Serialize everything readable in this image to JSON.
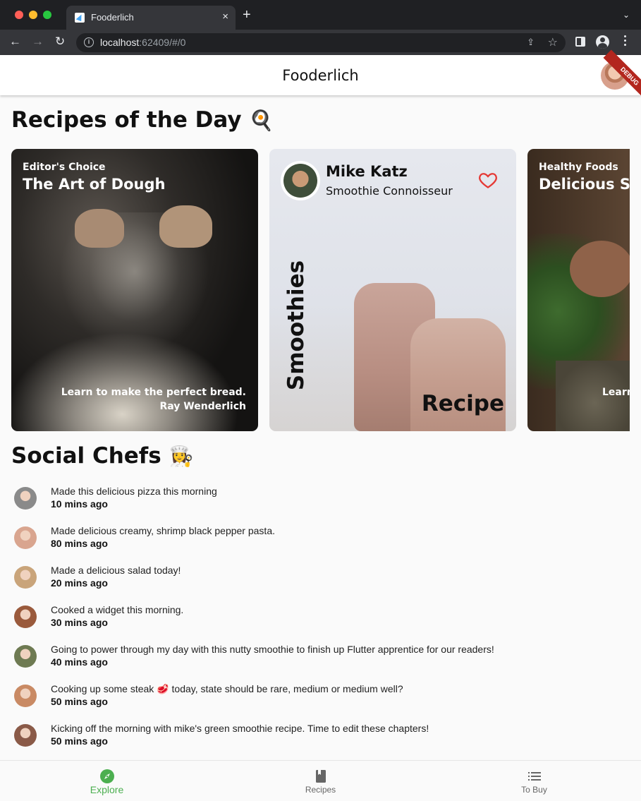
{
  "browser": {
    "tab_title": "Fooderlich",
    "tab_close": "×",
    "new_tab": "+",
    "tab_menu": "⌄",
    "url_host": "localhost",
    "url_rest": ":62409/#/0"
  },
  "app": {
    "title": "Fooderlich",
    "debug_label": "DEBUG",
    "accent_color": "#4caf50"
  },
  "recipes_section": {
    "title": "Recipes of the Day",
    "title_emoji": "🍳",
    "cards": [
      {
        "category": "Editor's Choice",
        "title": "The Art of Dough",
        "description": "Learn to make the perfect bread.",
        "author": "Ray Wenderlich"
      },
      {
        "author_name": "Mike Katz",
        "author_title": "Smoothie Connoisseur",
        "side_label": "Smoothies",
        "bottom_label": "Recipe",
        "favorite_icon": "heart-outline-icon"
      },
      {
        "category": "Healthy Foods",
        "title": "Delicious Sal",
        "description": "Learn"
      }
    ]
  },
  "social_section": {
    "title": "Social Chefs",
    "title_emoji": "👩‍🍳",
    "posts": [
      {
        "text": "Made this delicious pizza this morning",
        "time": "10 mins ago",
        "avatar_color": "#8a8a8a"
      },
      {
        "text": "Made delicious creamy, shrimp black pepper pasta.",
        "time": "80 mins ago",
        "avatar_color": "#d9a58f"
      },
      {
        "text": "Made a delicious salad today!",
        "time": "20 mins ago",
        "avatar_color": "#c9a47a"
      },
      {
        "text": "Cooked a widget this morning.",
        "time": "30 mins ago",
        "avatar_color": "#9a5a3c"
      },
      {
        "text": "Going to power through my day with this nutty smoothie to finish up Flutter apprentice for our readers!",
        "time": "40 mins ago",
        "avatar_color": "#6e7a52"
      },
      {
        "text": "Cooking up some steak 🥩 today, state should be rare, medium or medium well?",
        "time": "50 mins ago",
        "avatar_color": "#c98a64"
      },
      {
        "text": "Kicking off the morning with mike's green smoothie recipe. Time to edit these chapters!",
        "time": "50 mins ago",
        "avatar_color": "#8a5a48"
      }
    ]
  },
  "bottom_nav": {
    "items": [
      {
        "label": "Explore",
        "icon": "explore-compass-icon",
        "active": true
      },
      {
        "label": "Recipes",
        "icon": "book-icon",
        "active": false
      },
      {
        "label": "To Buy",
        "icon": "list-icon",
        "active": false
      }
    ]
  }
}
